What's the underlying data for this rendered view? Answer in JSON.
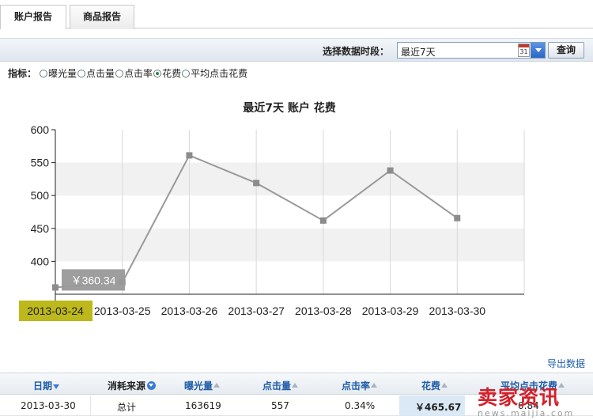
{
  "tabs": [
    {
      "label": "账户报告",
      "active": true
    },
    {
      "label": "商品报告",
      "active": false
    }
  ],
  "filter": {
    "label": "选择数据时段：",
    "selected": "最近7天",
    "calendar_day": "31",
    "query_label": "查询"
  },
  "metrics": {
    "label": "指标：",
    "options": [
      {
        "label": "曝光量",
        "checked": false
      },
      {
        "label": "点击量",
        "checked": false
      },
      {
        "label": "点击率",
        "checked": false
      },
      {
        "label": "花费",
        "checked": true
      },
      {
        "label": "平均点击花费",
        "checked": false
      }
    ]
  },
  "chart_data": {
    "type": "line",
    "title": "最近7天 账户 花费",
    "categories": [
      "2013-03-24",
      "2013-03-25",
      "2013-03-26",
      "2013-03-27",
      "2013-03-28",
      "2013-03-29",
      "2013-03-30"
    ],
    "values": [
      360.34,
      368,
      561,
      519,
      462,
      538,
      465.67
    ],
    "ylim": [
      350,
      600
    ],
    "yticks": [
      400,
      450,
      500,
      550,
      600
    ],
    "grid": true,
    "tooltip": "￥360.34",
    "highlight_index": 0,
    "colors": {
      "line": "#999999",
      "band": "#f1f1f1",
      "highlight": "#bdb81b",
      "tooltip": "#999999"
    }
  },
  "export_label": "导出数据",
  "table": {
    "headers": [
      {
        "label": "日期",
        "icon": "sort-down-icon"
      },
      {
        "label": "消耗来源",
        "icon": "dropdown-circle-icon"
      },
      {
        "label": "曝光量",
        "icon": "sort-up-icon"
      },
      {
        "label": "点击量",
        "icon": "sort-up-icon"
      },
      {
        "label": "点击率",
        "icon": "sort-up-icon"
      },
      {
        "label": "花费",
        "icon": "sort-up-icon"
      },
      {
        "label": "平均点击花费",
        "icon": "sort-up-icon"
      }
    ],
    "row": {
      "date": "2013-03-30",
      "source": "总计",
      "impressions": "163619",
      "clicks": "557",
      "ctr": "0.34%",
      "cost": "￥465.67",
      "avg_cpc": "0.84"
    }
  },
  "watermark": {
    "text": "卖家资讯",
    "url": "news.maijia.com"
  }
}
